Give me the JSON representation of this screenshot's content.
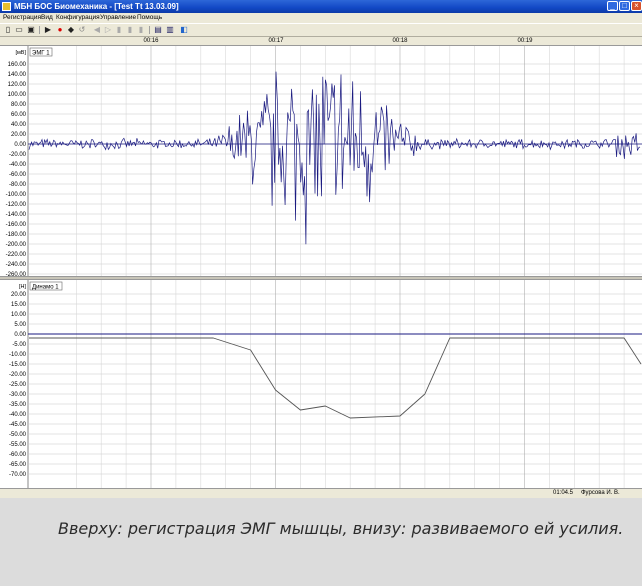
{
  "window": {
    "title": "МБН БОС Биомеханика - [Test Tt 13.03.09]",
    "controls": {
      "minimize": "_",
      "maximize": "□",
      "close": "×"
    }
  },
  "menu": [
    "Регистрация",
    "Вид",
    "Конфигурация",
    "Управление",
    "Помощь"
  ],
  "toolbar": {
    "icons": [
      "new-file-icon",
      "open-icon",
      "save-icon",
      "play-icon",
      "record-icon",
      "step-icon",
      "rewind-icon",
      "back-icon",
      "pause-icon",
      "forward-icon",
      "end-icon",
      "settings-icon",
      "graph-icon",
      "export-icon"
    ]
  },
  "time_axis": {
    "ticks": [
      "00:16",
      "00:17",
      "00:18",
      "00:19"
    ]
  },
  "emg_panel": {
    "unit": "[мВ]",
    "channel": "ЭМГ 1",
    "y_ticks": [
      "160.00",
      "140.00",
      "120.00",
      "100.00",
      "80.00",
      "60.00",
      "40.00",
      "20.00",
      "0.00",
      "-20.00",
      "-40.00",
      "-60.00",
      "-80.00",
      "-100.00",
      "-120.00",
      "-140.00",
      "-160.00",
      "-180.00",
      "-200.00",
      "-220.00",
      "-240.00",
      "-260.00"
    ]
  },
  "dyn_panel": {
    "unit": "[Н]",
    "channel": "Динамо 1",
    "y_ticks": [
      "20.00",
      "15.00",
      "10.00",
      "5.00",
      "0.00",
      "-5.00",
      "-10.00",
      "-15.00",
      "-20.00",
      "-25.00",
      "-30.00",
      "-35.00",
      "-40.00",
      "-45.00",
      "-50.00",
      "-55.00",
      "-60.00",
      "-65.00",
      "-70.00"
    ]
  },
  "chart_data": [
    {
      "type": "line",
      "title": "ЭМГ 1",
      "ylabel": "[мВ]",
      "ylim": [
        -270,
        170
      ],
      "x": [
        "00:16",
        "00:17",
        "00:18",
        "00:19"
      ],
      "series_shape": {
        "baseline_amplitude": 12,
        "burst_amplitude": 230,
        "burst_start": "00:16.5",
        "burst_end": "00:18.2"
      },
      "line_color": "#1a1a80",
      "grid": true
    },
    {
      "type": "line",
      "title": "Динамо 1",
      "ylabel": "[Н]",
      "ylim": [
        -72,
        22
      ],
      "x": [
        "00:15.8",
        "00:16.5",
        "00:16.8",
        "00:17.0",
        "00:17.2",
        "00:17.4",
        "00:17.6",
        "00:18.0",
        "00:18.2",
        "00:18.4",
        "00:19.0",
        "00:19.8",
        "00:20.0"
      ],
      "values": [
        -2,
        -2,
        -8,
        -28,
        -38,
        -36,
        -42,
        -41,
        -30,
        -2,
        -2,
        -2,
        -15
      ],
      "line_color": "#555555",
      "grid": true
    }
  ],
  "status": {
    "time": "01:04.5",
    "user": "Фурсова И. В."
  },
  "caption": "Вверху: регистрация ЭМГ мышцы, внизу: развиваемого ей усилия."
}
